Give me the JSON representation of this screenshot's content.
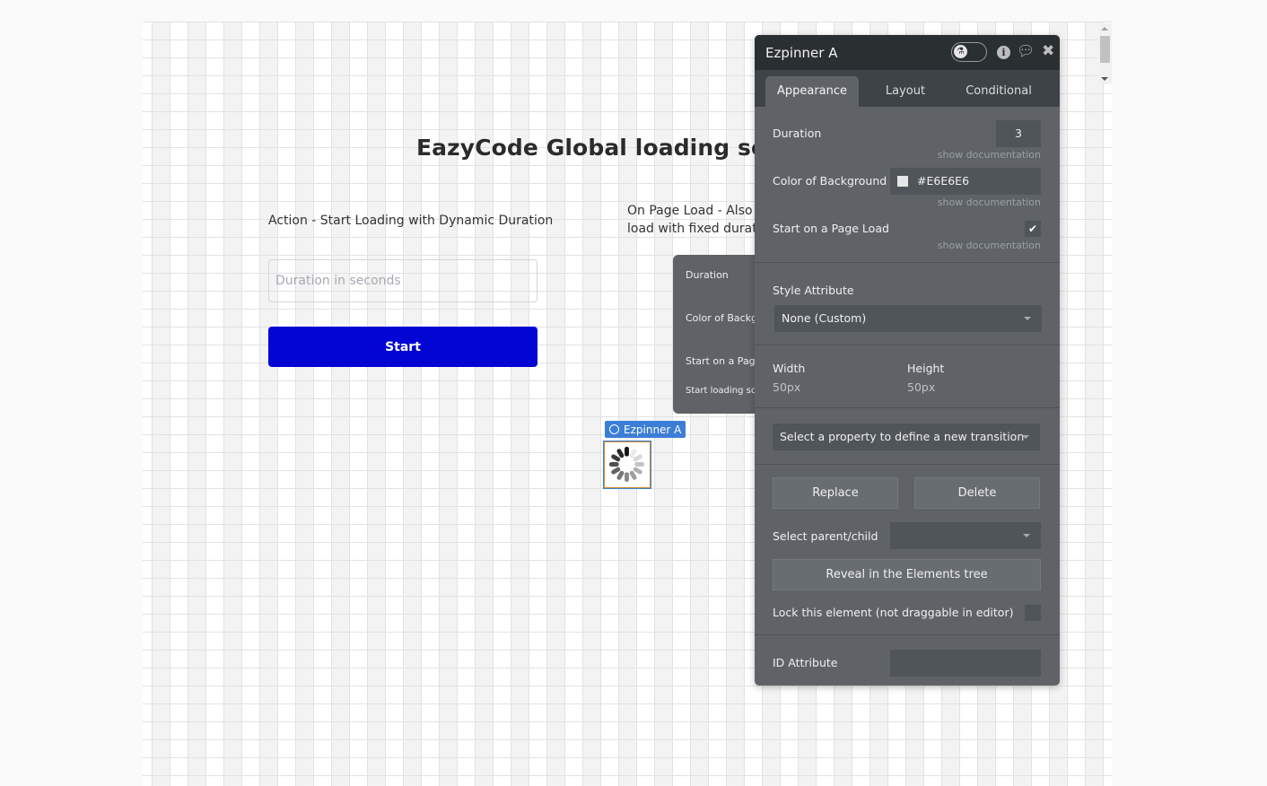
{
  "canvas": {
    "title": "EazyCode Global loading screen",
    "left_section_label": "Action - Start Loading with Dynamic Duration",
    "right_section_label": "On Page Load - Also p... load with fixed durati...",
    "right_section_line1": "On Page Load - Also p",
    "right_section_line2": "load with fixed durati",
    "duration_input": {
      "placeholder": "Duration in seconds",
      "value": ""
    },
    "start_button": "Start",
    "ghost_panel": {
      "labels": [
        "Duration",
        "Color of Backgr",
        "Start on a Page",
        "Start loading scr"
      ]
    },
    "spinner_tag": "Ezpinner A",
    "spinner_colors": {
      "primary_button": "#0205D3",
      "selection_tag": "#3C7ED6"
    }
  },
  "editor": {
    "title": "Ezpinner A",
    "tabs": [
      {
        "label": "Appearance",
        "active": true
      },
      {
        "label": "Layout",
        "active": false
      },
      {
        "label": "Conditional",
        "active": false
      }
    ],
    "duration": {
      "label": "Duration",
      "value": "3",
      "doc": "show documentation"
    },
    "color_bg": {
      "label": "Color of Background",
      "value": "#E6E6E6",
      "doc": "show documentation"
    },
    "start_on_load": {
      "label": "Start on a Page Load",
      "checked": true,
      "check_glyph": "✔",
      "doc": "show documentation"
    },
    "style_attribute": {
      "label": "Style Attribute",
      "value": "None (Custom)"
    },
    "width": {
      "label": "Width",
      "value": "50px"
    },
    "height": {
      "label": "Height",
      "value": "50px"
    },
    "transition_select": "Select a property to define a new transition",
    "replace_button": "Replace",
    "delete_button": "Delete",
    "parent_child": {
      "label": "Select parent/child",
      "value": ""
    },
    "reveal_button": "Reveal in the Elements tree",
    "lock": {
      "label": "Lock this element (not draggable in editor)",
      "checked": false
    },
    "id_attribute": {
      "label": "ID Attribute",
      "value": ""
    }
  }
}
